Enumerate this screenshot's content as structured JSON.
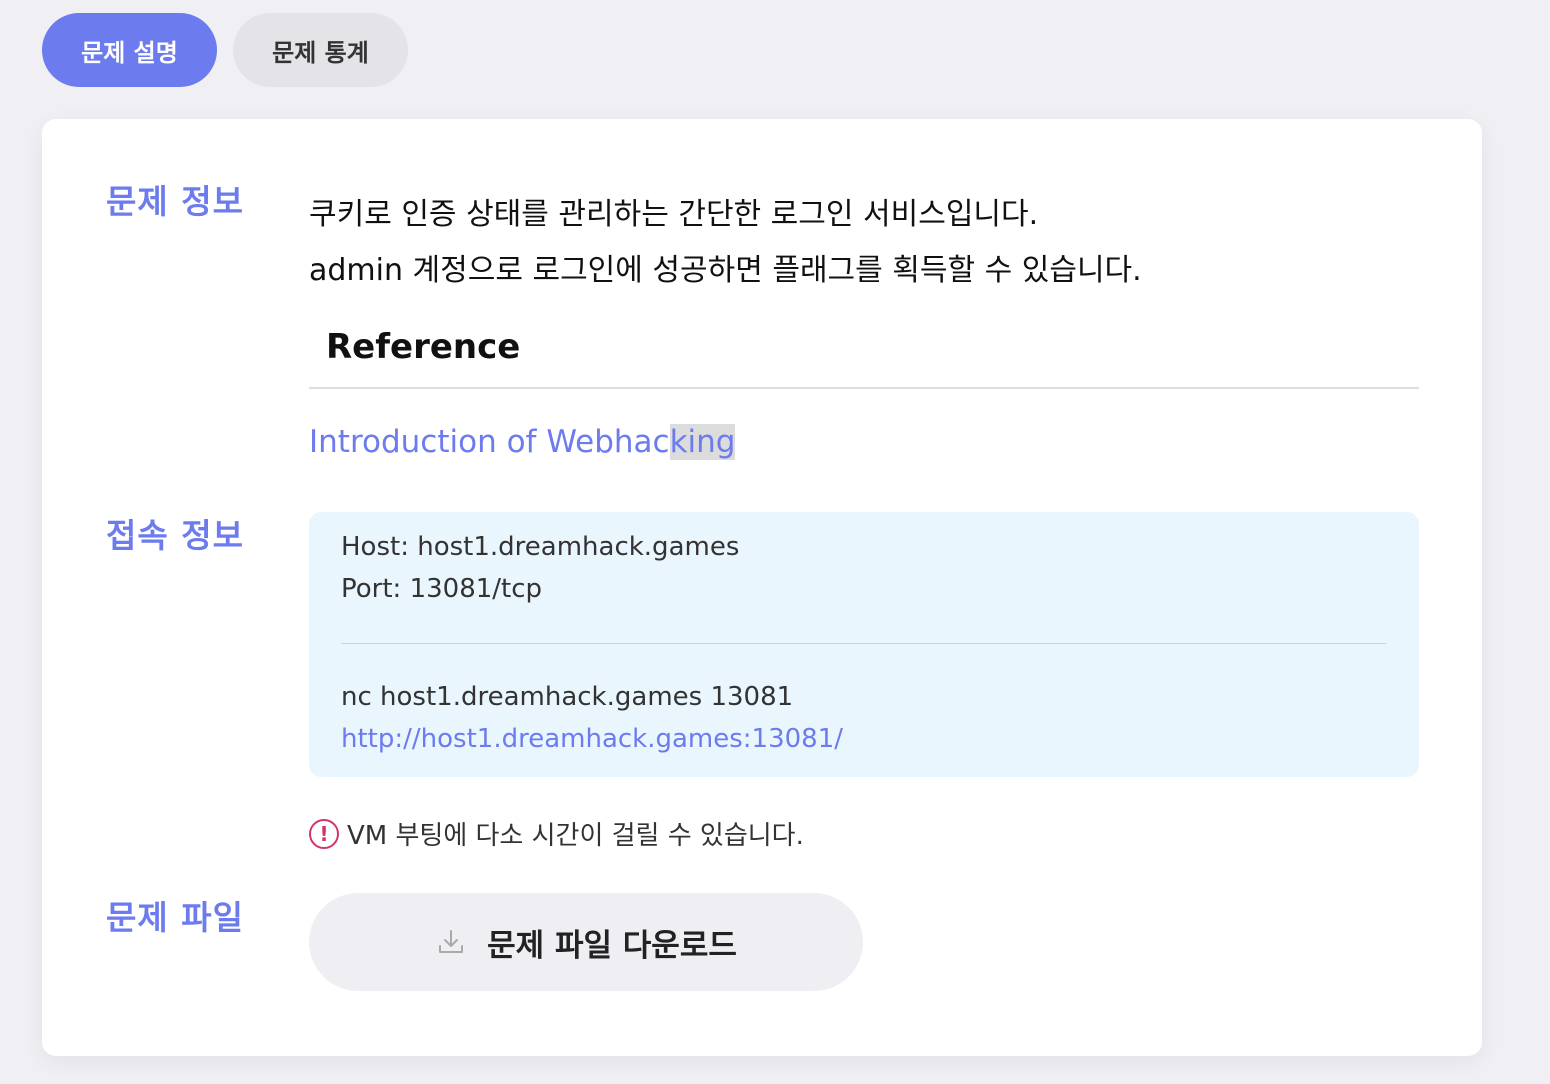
{
  "tabs": [
    {
      "label": "문제 설명",
      "active": true
    },
    {
      "label": "문제 통계",
      "active": false
    }
  ],
  "sections": {
    "info_label": "문제 정보",
    "connect_label": "접속 정보",
    "file_label": "문제 파일"
  },
  "description": {
    "line1": "쿠키로 인증 상태를 관리하는 간단한 로그인 서비스입니다.",
    "line2": "admin 계정으로 로그인에 성공하면 플래그를 획득할 수 있습니다."
  },
  "reference": {
    "title": "Reference",
    "link_text_main": "Introduction of Webhac",
    "link_text_selected": "king"
  },
  "connection": {
    "host": "Host: host1.dreamhack.games",
    "port": "Port: 13081/tcp",
    "nc": "nc host1.dreamhack.games 13081",
    "url": "http://host1.dreamhack.games:13081/"
  },
  "notice": "VM 부팅에 다소 시간이 걸릴 수 있습니다.",
  "download_label": "문제 파일 다운로드",
  "colors": {
    "accent": "#6c7bee",
    "warning": "#d6336c",
    "conn_bg": "#eaf6fd"
  }
}
